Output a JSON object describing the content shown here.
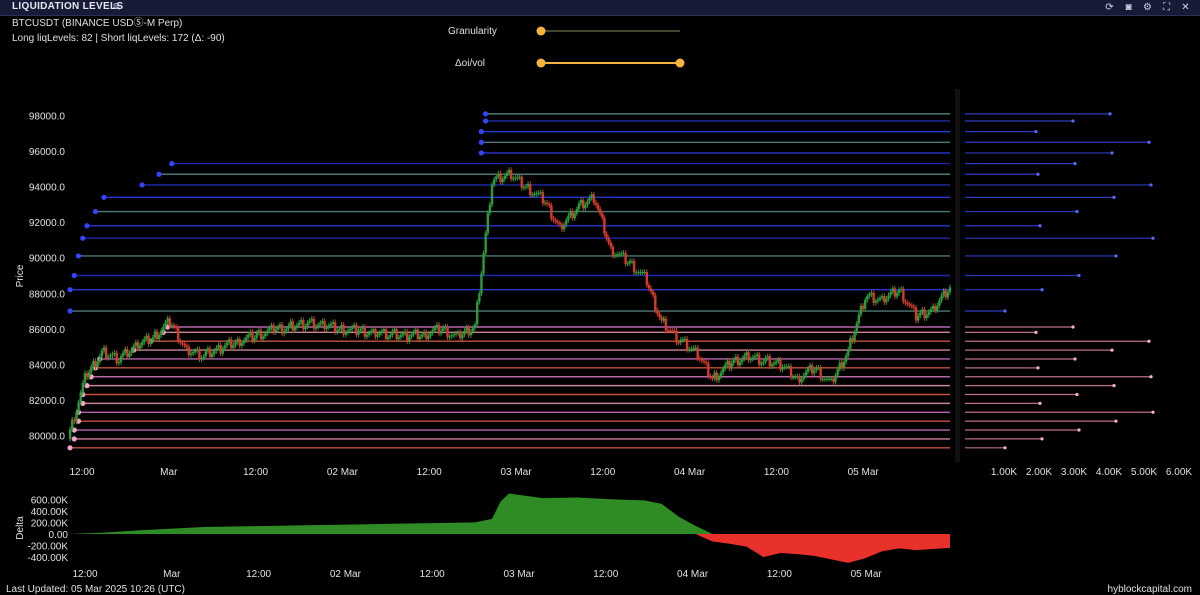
{
  "window": {
    "title": "LIQUIDATION LEVELS",
    "tune_icon": "sliders-icon",
    "tool_icons": [
      "refresh-icon",
      "camera-icon",
      "gear-icon",
      "expand-icon",
      "close-icon"
    ]
  },
  "header": {
    "symbol": "BTCUSDT (BINANCE USDⓈ-M Perp)",
    "levels": "Long liqLevels: 82 | Short liqLevels: 172 (Δ: -90)"
  },
  "controls": {
    "granularity_label": "Granularity",
    "granularity_value": 0.0,
    "oi_label": "Δoi/vol",
    "oi_range": [
      0.0,
      1.0
    ]
  },
  "footer": {
    "updated": "Last Updated: 05 Mar 2025 10:26 (UTC)",
    "brand": "hyblockcapital.com"
  },
  "chart_data": [
    {
      "type": "line",
      "role": "price-candles",
      "ylabel": "Price",
      "ylim": [
        78500,
        99500
      ],
      "yticks": [
        80000,
        82000,
        84000,
        86000,
        88000,
        90000,
        92000,
        94000,
        96000,
        98000
      ],
      "ytick_labels": [
        "80000.0",
        "82000.0",
        "84000.0",
        "86000.0",
        "88000.0",
        "90000.0",
        "92000.0",
        "94000.0",
        "96000.0",
        "98000.0"
      ],
      "xlim": [
        0,
        104
      ],
      "xticks": [
        0,
        12,
        24,
        36,
        48,
        60,
        72,
        84,
        96
      ],
      "xtick_labels": [
        "12:00",
        "Mar",
        "12:00",
        "02 Mar",
        "12:00",
        "03 Mar",
        "12:00",
        "04 Mar",
        "12:00",
        "05 Mar"
      ],
      "xtick_positions": [
        0,
        12,
        24,
        36,
        48,
        60,
        72,
        84,
        96,
        108
      ],
      "x_unit": "hours from 28 Feb 12:00 UTC",
      "x": [
        0,
        2,
        4,
        6,
        8,
        10,
        12,
        14,
        16,
        18,
        20,
        22,
        24,
        26,
        28,
        30,
        32,
        34,
        36,
        38,
        40,
        42,
        44,
        46,
        48,
        50,
        52,
        54,
        56,
        58,
        60,
        62,
        64,
        66,
        68,
        70,
        72,
        74,
        76,
        78,
        80,
        82,
        84,
        86,
        88,
        90,
        92,
        94,
        96,
        98,
        100,
        102,
        104
      ],
      "close": [
        79800,
        83200,
        84700,
        84300,
        85000,
        85500,
        86400,
        84800,
        84500,
        84900,
        85300,
        85600,
        85900,
        86100,
        86300,
        86200,
        86000,
        85900,
        85800,
        85700,
        85600,
        85700,
        86000,
        85500,
        86200,
        94300,
        94700,
        94000,
        93300,
        91700,
        92800,
        93400,
        90500,
        89800,
        88900,
        86400,
        85400,
        84700,
        83200,
        84000,
        84500,
        84200,
        84000,
        83200,
        83800,
        82900,
        84800,
        87800,
        87600,
        88200,
        86700,
        87100,
        88400
      ]
    },
    {
      "type": "bar",
      "role": "liquidation-levels",
      "description_from_chart": "horizontal liquidation level lines and volume profile",
      "series": [
        {
          "side": "short",
          "color": "#2e3af0",
          "levels": [
            87000,
            88200,
            89000,
            90100,
            91100,
            91800,
            92600,
            93400,
            94100,
            94700,
            95300,
            95900,
            96500,
            97100,
            97700,
            98100
          ]
        },
        {
          "side": "long",
          "color": "#f08aa0",
          "levels": [
            79300,
            79800,
            80300,
            80800,
            81300,
            81800,
            82300,
            82800,
            83300,
            83800,
            84300,
            84800,
            85300,
            85800,
            86100
          ]
        }
      ],
      "profile_xticks": [
        "1.00K",
        "2.00K",
        "3.00K",
        "4.00K",
        "5.00K",
        "6.00K"
      ]
    },
    {
      "type": "area",
      "role": "delta",
      "ylabel": "Delta",
      "ylim": [
        -520000,
        760000
      ],
      "yticks": [
        -400000,
        -200000,
        0,
        200000,
        400000,
        600000
      ],
      "ytick_labels": [
        "-400.00K",
        "-200.00K",
        "0.00",
        "200.00K",
        "400.00K",
        "600.00K"
      ],
      "positive_color": "#2f8c24",
      "negative_color": "#e8312a",
      "x": [
        0,
        4,
        8,
        12,
        16,
        20,
        24,
        28,
        32,
        36,
        40,
        44,
        48,
        50,
        51,
        52,
        56,
        60,
        64,
        68,
        70,
        72,
        74,
        76,
        78,
        80,
        82,
        84,
        86,
        88,
        90,
        92,
        94,
        96,
        98,
        100,
        104
      ],
      "values": [
        0,
        20000,
        60000,
        90000,
        120000,
        130000,
        140000,
        150000,
        160000,
        170000,
        180000,
        190000,
        200000,
        260000,
        560000,
        700000,
        620000,
        630000,
        600000,
        580000,
        520000,
        300000,
        140000,
        -130000,
        -170000,
        -220000,
        -400000,
        -330000,
        -350000,
        -380000,
        -440000,
        -500000,
        -420000,
        -300000,
        -250000,
        -280000,
        -240000
      ]
    }
  ]
}
